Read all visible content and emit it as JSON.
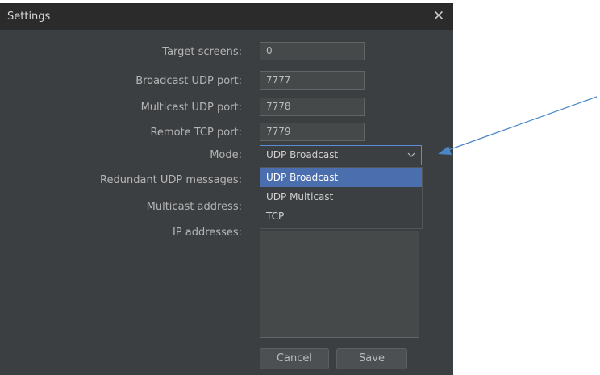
{
  "dialog": {
    "title": "Settings",
    "close_glyph": "✕"
  },
  "form": {
    "target_screens_label": "Target screens:",
    "target_screens_value": "0",
    "broadcast_udp_port_label": "Broadcast UDP port:",
    "broadcast_udp_port_value": "7777",
    "multicast_udp_port_label": "Multicast UDP port:",
    "multicast_udp_port_value": "7778",
    "remote_tcp_port_label": "Remote TCP port:",
    "remote_tcp_port_value": "7779",
    "mode_label": "Mode:",
    "mode_value": "UDP Broadcast",
    "redundant_udp_label": "Redundant UDP messages:",
    "multicast_address_label": "Multicast address:",
    "ip_addresses_label": "IP addresses:"
  },
  "mode_options": [
    "UDP Broadcast",
    "UDP Multicast",
    "TCP"
  ],
  "buttons": {
    "cancel": "Cancel",
    "save": "Save"
  },
  "icons": {
    "close": "close-icon",
    "dropdown": "chevron-down-icon",
    "annotation": "arrow-annotation"
  },
  "colors": {
    "title_bar": "#2b2b2b",
    "dialog_bg": "#3c3f41",
    "selection": "#4b6eaf",
    "annotation_arrow": "#4a86c5"
  }
}
